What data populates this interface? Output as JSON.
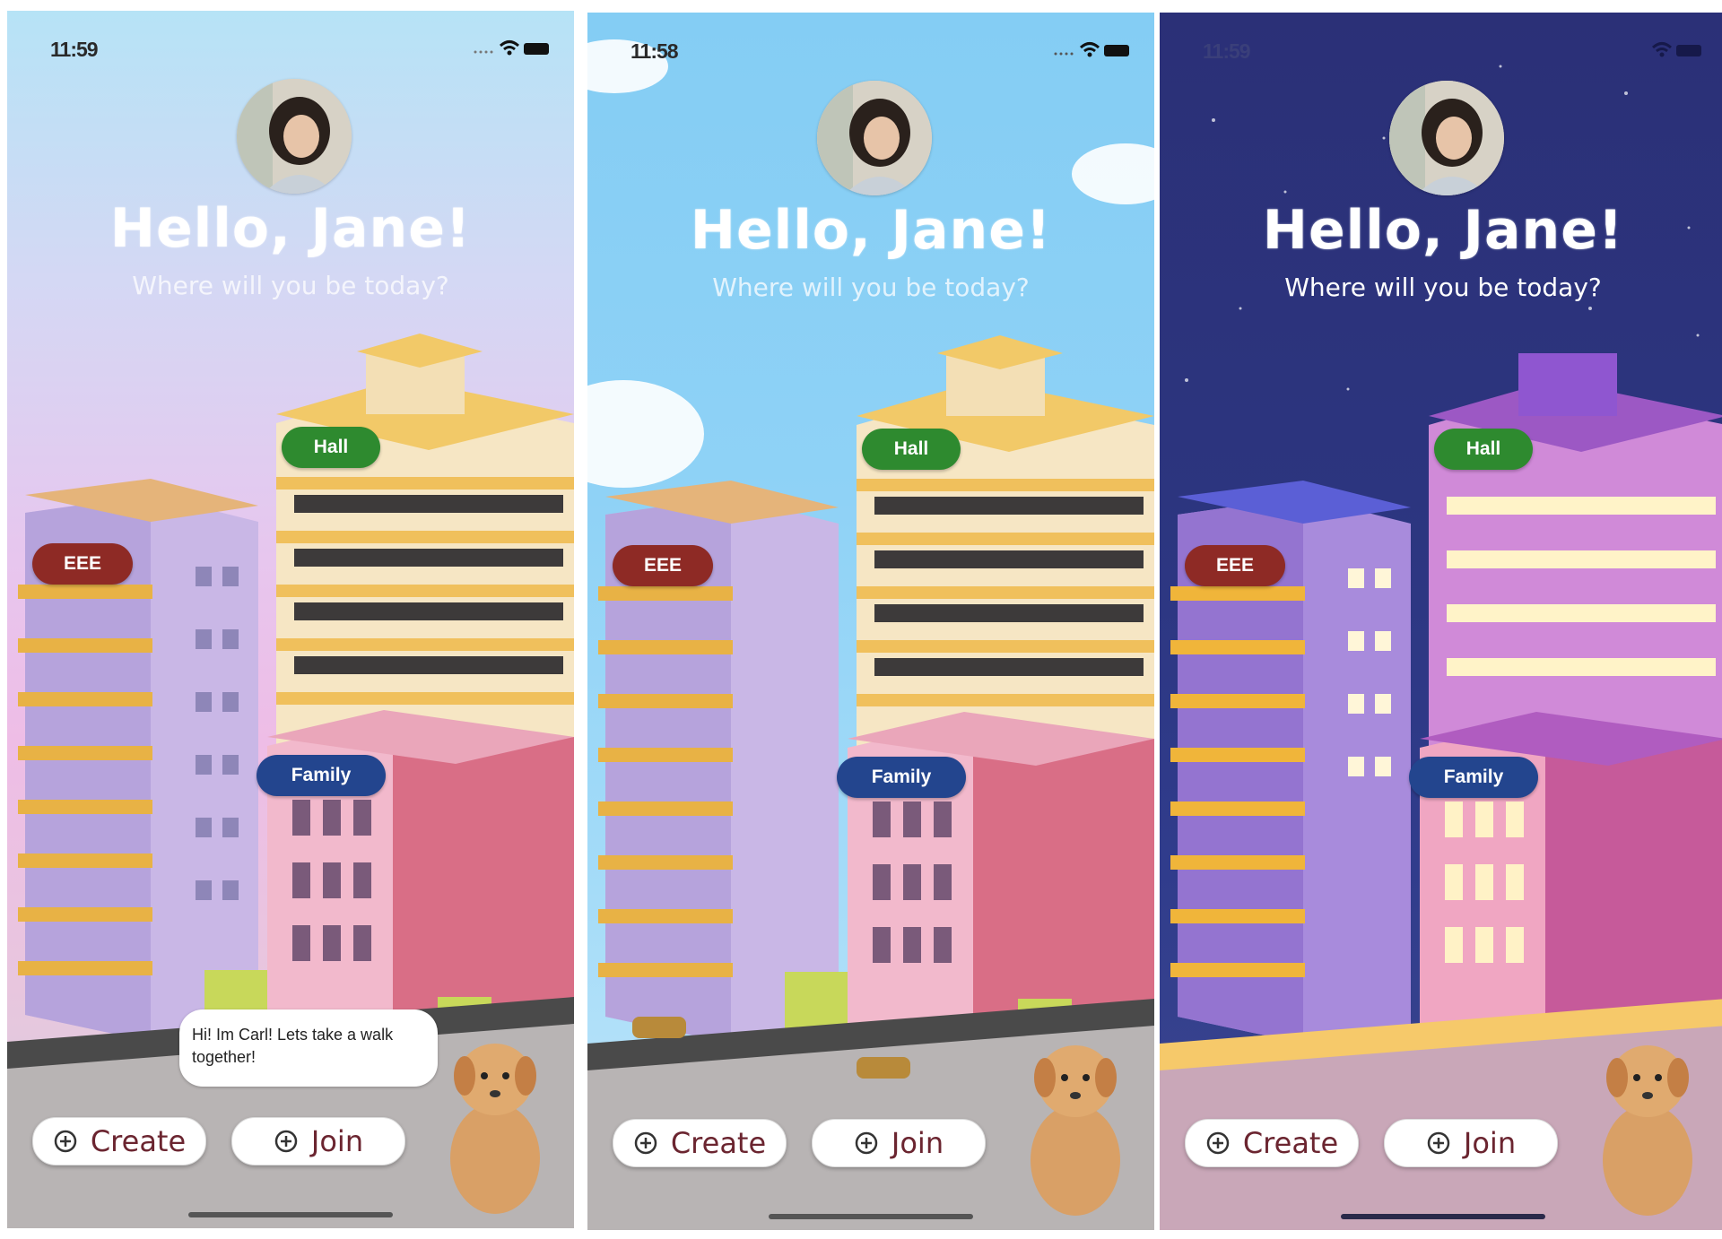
{
  "screens": [
    {
      "theme": "dusk",
      "status": {
        "time": "11:59"
      },
      "greeting": "Hello, Jane!",
      "subtitle": "Where will you be today?",
      "buildings": {
        "hall": "Hall",
        "eee": "EEE",
        "family": "Family"
      },
      "companion_message": "Hi! Im Carl! Lets take a walk together!",
      "actions": {
        "create": "Create",
        "join": "Join"
      }
    },
    {
      "theme": "day",
      "status": {
        "time": "11:58"
      },
      "greeting": "Hello, Jane!",
      "subtitle": "Where will you be today?",
      "buildings": {
        "hall": "Hall",
        "eee": "EEE",
        "family": "Family"
      },
      "actions": {
        "create": "Create",
        "join": "Join"
      }
    },
    {
      "theme": "night",
      "status": {
        "time": "11:59"
      },
      "greeting": "Hello, Jane!",
      "subtitle": "Where will you be today?",
      "buildings": {
        "hall": "Hall",
        "eee": "EEE",
        "family": "Family"
      },
      "actions": {
        "create": "Create",
        "join": "Join"
      }
    }
  ],
  "colors": {
    "hall_badge": "#2e8a2f",
    "eee_badge": "#8e2a25",
    "family_badge": "#23458e",
    "button_text": "#6b2530"
  },
  "icons": [
    "wifi-icon",
    "battery-icon",
    "signal-icon",
    "plus-circle-icon"
  ]
}
